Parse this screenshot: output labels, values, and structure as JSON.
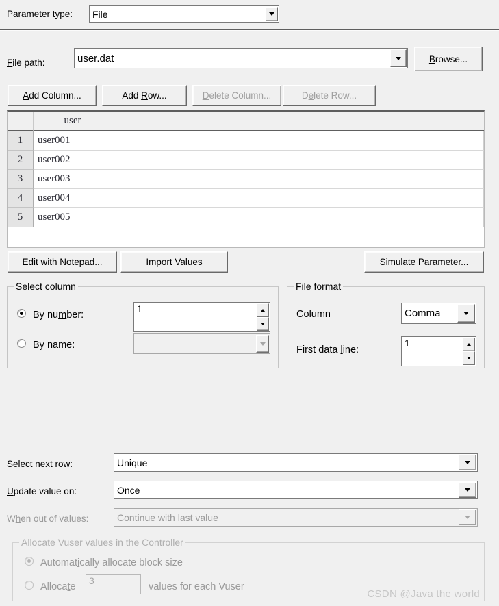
{
  "parameter_type": {
    "label": "Parameter type:",
    "accel": "P",
    "value": "File"
  },
  "file_path": {
    "label": "File path:",
    "accel": "F",
    "value": "user.dat",
    "browse_label": "Browse...",
    "browse_accel": "B"
  },
  "grid_toolbar": {
    "add_column": "Add Column...",
    "add_column_accel": "A",
    "add_row": "Add Row...",
    "add_row_accel": "R",
    "delete_column": "Delete Column...",
    "delete_column_accel": "D",
    "delete_column_enabled": false,
    "delete_row": "Delete Row...",
    "delete_row_accel": "e",
    "delete_row_enabled": false
  },
  "table": {
    "columns": [
      "user"
    ],
    "row_numbers": [
      "1",
      "2",
      "3",
      "4",
      "5"
    ],
    "rows": [
      [
        "user001"
      ],
      [
        "user002"
      ],
      [
        "user003"
      ],
      [
        "user004"
      ],
      [
        "user005"
      ]
    ]
  },
  "actions": {
    "edit_notepad": "Edit with Notepad...",
    "edit_notepad_accel": "E",
    "import_values": "Import Values",
    "simulate_parameter": "Simulate Parameter...",
    "simulate_parameter_accel": "S"
  },
  "select_column": {
    "title": "Select column",
    "by_number_label": "By number:",
    "by_number_accel": "m",
    "by_number_selected": true,
    "by_number_value": "1",
    "by_name_label": "By name:",
    "by_name_accel": "y",
    "by_name_selected": false,
    "by_name_value": ""
  },
  "file_format": {
    "title": "File format",
    "column_label": "Column",
    "column_accel": "o",
    "column_value": "Comma",
    "first_data_line_label": "First data line:",
    "first_data_line_accel": "l",
    "first_data_line_value": "1"
  },
  "options": [
    {
      "label": "Select next row:",
      "accel": "S",
      "value": "Unique",
      "enabled": true
    },
    {
      "label": "Update value on:",
      "accel": "U",
      "value": "Once",
      "enabled": true
    },
    {
      "label": "When out of values:",
      "accel": "h",
      "value": "Continue with last value",
      "enabled": false
    }
  ],
  "allocate": {
    "title": "Allocate Vuser values in the Controller",
    "auto_label": "Automatically allocate block size",
    "auto_accel": "i",
    "auto_selected": true,
    "manual_label": "Allocate",
    "manual_accel": "t",
    "manual_selected": false,
    "manual_value": "3",
    "manual_suffix": "values for each Vuser",
    "enabled": false
  },
  "watermark": "CSDN @Java the world",
  "colors": {
    "background": "#f0f0f0",
    "field_background": "#ffffff",
    "border": "#7a7a7a",
    "disabled_text": "#9a9a9a",
    "row_header": "#e4e4e4",
    "watermark": "#c6c6c6"
  }
}
